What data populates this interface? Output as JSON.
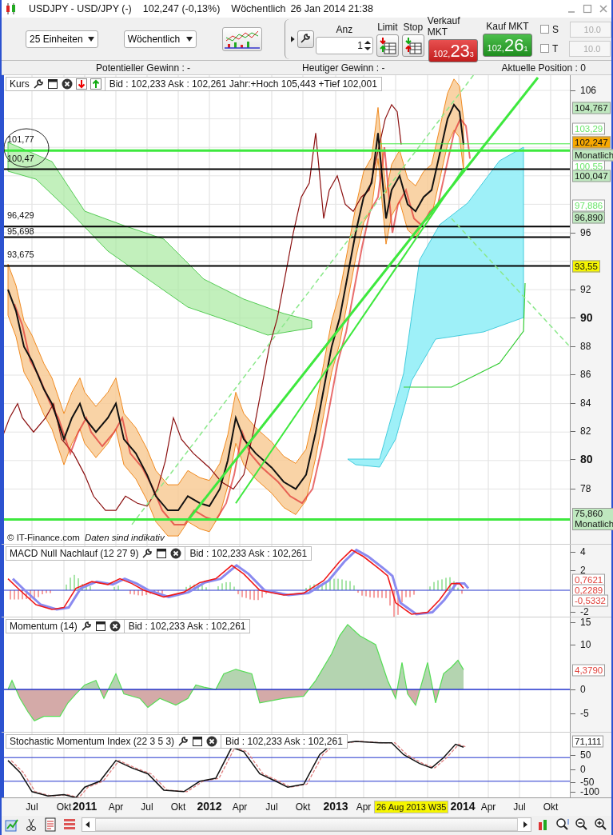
{
  "window": {
    "title": "USDJPY - USD/JPY (-)",
    "price": "102,247 (-0,13%)",
    "interval": "Wöchentlich",
    "datetime": "26 Jan 2014 21:38"
  },
  "toolbar": {
    "units_dropdown": "25 Einheiten",
    "interval_dropdown": "Wöchentlich",
    "quantity_label": "Anz",
    "quantity": "1",
    "limit_label": "Limit",
    "stop_label": "Stop",
    "sell": {
      "label": "Verkauf MKT",
      "price_prefix": "102,",
      "price_main": "23",
      "price_sup": "3"
    },
    "buy": {
      "label": "Kauf MKT",
      "price_prefix": "102,",
      "price_main": "26",
      "price_sup": "1"
    },
    "s_field": {
      "label": "S",
      "checked": false,
      "value": "10.0"
    },
    "t_field": {
      "label": "T",
      "checked": false,
      "value": "10.0"
    }
  },
  "summary": [
    "Potentieller Gewinn : -",
    "Heutiger Gewinn : -",
    "Aktuelle Position : 0"
  ],
  "price_panel": {
    "title": "Kurs",
    "quote": "Bid : 102,233 Ask : 102,261 Jahr:+Hoch 105,443 +Tief 102,001",
    "line_labels": [
      "101,77",
      "100,47",
      "96,429",
      "95,698",
      "93,675"
    ],
    "axis_ticks": [
      {
        "label": "106",
        "kind": "minor"
      },
      {
        "label": "96",
        "kind": "minor"
      },
      {
        "label": "92",
        "kind": "minor"
      },
      {
        "label": "90",
        "kind": "major"
      },
      {
        "label": "88",
        "kind": "minor"
      },
      {
        "label": "86",
        "kind": "minor"
      },
      {
        "label": "84",
        "kind": "minor"
      },
      {
        "label": "82",
        "kind": "minor"
      },
      {
        "label": "80",
        "kind": "major"
      },
      {
        "label": "78",
        "kind": "minor"
      }
    ],
    "price_tags": [
      {
        "text": "104,767",
        "kind": "plain"
      },
      {
        "text": "103,29",
        "kind": "light"
      },
      {
        "text": "102,247",
        "kind": "current"
      },
      {
        "text": "Monatlich",
        "kind": "plain"
      },
      {
        "text": "100,55",
        "kind": "light"
      },
      {
        "text": "100,047",
        "kind": "plain"
      },
      {
        "text": "97,886",
        "kind": "light"
      },
      {
        "text": "96,890",
        "kind": "plain"
      },
      {
        "text": "93,55",
        "kind": "highlight"
      },
      {
        "text": "75,860",
        "note": "Monatlich",
        "kind": "plain"
      }
    ],
    "copyright": "© IT-Finance.com",
    "disclaimer": "Daten sind indikativ"
  },
  "indicators": [
    {
      "kind": "macd",
      "title": "MACD Null Nachlauf (12 27 9)",
      "quote": "Bid : 102,233 Ask : 102,261",
      "axis_ticks": [
        "4",
        "2",
        "-2"
      ],
      "value_tags": [
        "0,7621",
        "0,2289",
        "-0,5332"
      ]
    },
    {
      "kind": "momentum",
      "title": "Momentum (14)",
      "quote": "Bid : 102,233 Ask : 102,261",
      "axis_ticks": [
        "15",
        "10",
        "0",
        "-5"
      ],
      "value_tags": [
        "4,3790"
      ]
    },
    {
      "kind": "stochastic",
      "title": "Stochastic Momentum Index (22 3 5 3)",
      "quote": "Bid : 102,233 Ask : 102,261",
      "axis_ticks": [
        "50",
        "0",
        "-50",
        "-100"
      ],
      "value_tags": [
        "71,111"
      ]
    }
  ],
  "x_axis": {
    "labels": [
      {
        "text": "Jul",
        "kind": "month"
      },
      {
        "text": "Okt",
        "kind": "month"
      },
      {
        "text": "2011",
        "kind": "year"
      },
      {
        "text": "Apr",
        "kind": "month"
      },
      {
        "text": "Jul",
        "kind": "month"
      },
      {
        "text": "Okt",
        "kind": "month"
      },
      {
        "text": "2012",
        "kind": "year"
      },
      {
        "text": "Apr",
        "kind": "month"
      },
      {
        "text": "Jul",
        "kind": "month"
      },
      {
        "text": "Okt",
        "kind": "month"
      },
      {
        "text": "2013",
        "kind": "year"
      },
      {
        "text": "Apr",
        "kind": "month"
      },
      {
        "text": "2014",
        "kind": "year"
      },
      {
        "text": "Apr",
        "kind": "month"
      },
      {
        "text": "Jul",
        "kind": "month"
      },
      {
        "text": "Okt",
        "kind": "month"
      }
    ],
    "cursor_label": "26 Aug 2013 W35"
  }
}
